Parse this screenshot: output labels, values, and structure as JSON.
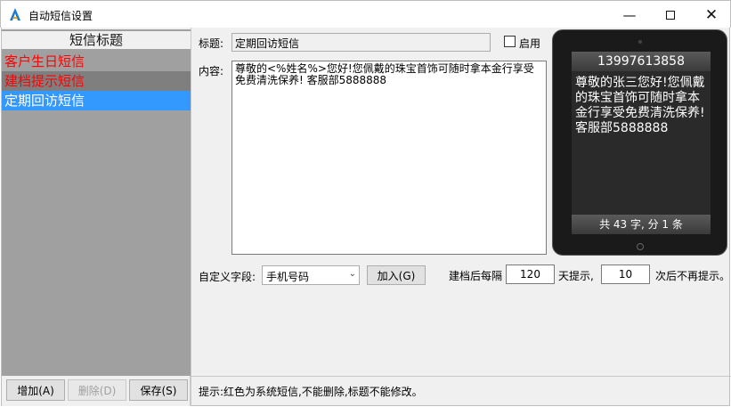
{
  "window": {
    "title": "自动短信设置",
    "minimize_icon": "minimize-icon",
    "maximize_icon": "maximize-icon",
    "close_icon": "close-icon"
  },
  "sms_list": {
    "header": "短信标题",
    "items": [
      {
        "label": "客户生日短信",
        "color": "#ff0000"
      },
      {
        "label": "建档提示短信",
        "color": "#ff0000"
      },
      {
        "label": "定期回访短信",
        "color": "#ffffff",
        "selected": true
      }
    ]
  },
  "buttons": {
    "add": "增加(A)",
    "delete": "删除(D)",
    "save": "保存(S)",
    "insert": "加入(G)"
  },
  "form": {
    "title_label": "标题:",
    "title_value": "定期回访短信",
    "enable_label": "启用",
    "enable_checked": false,
    "content_label": "内容:",
    "content_value": "尊敬的<%姓名%>您好!您佩戴的珠宝首饰可随时拿本金行享受免费清洗保养! 客服部5888888",
    "custom_field_label": "自定义字段:",
    "custom_field_value": "手机号码",
    "interval_label": "建档后每隔",
    "interval_days": "120",
    "days_remind_label": "天提示,",
    "remind_times": "10",
    "no_more_label": "次后不再提示。"
  },
  "phone_preview": {
    "phone_number": "13997613858",
    "message": "尊敬的张三您好!您佩戴的珠宝首饰可随时拿本金行享受免费清洗保养! 客服部5888888",
    "stats": "共 43 字, 分 1 条"
  },
  "hint": "提示:红色为系统短信,不能删除,标题不能修改。"
}
